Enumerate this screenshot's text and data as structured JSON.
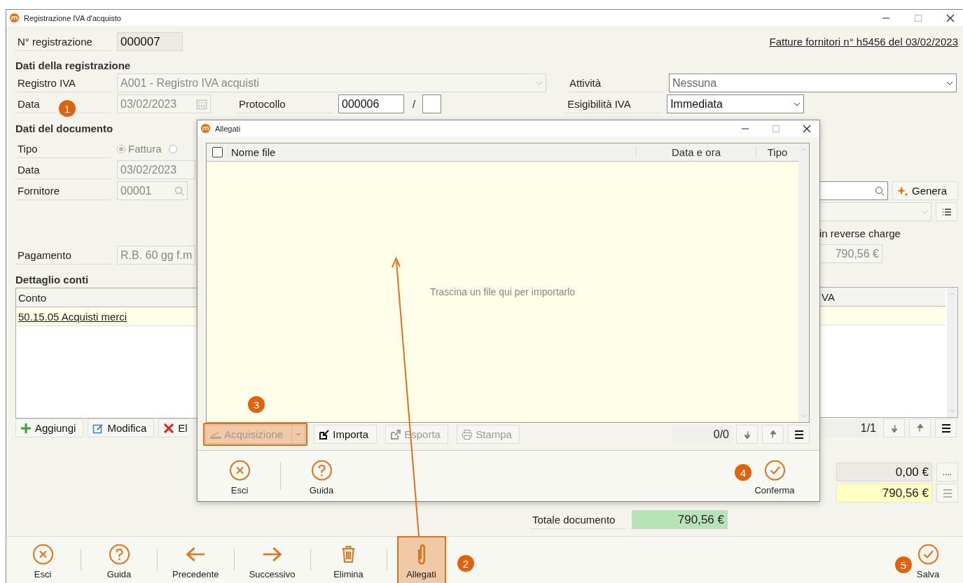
{
  "window": {
    "title": "Registrazione IVA d'acquisto"
  },
  "header": {
    "registration_label": "N° registrazione",
    "registration_number": "000007",
    "invoice_link": "Fatture fornitori n° h5456 del 03/02/2023"
  },
  "registration_section": {
    "title": "Dati della registrazione",
    "registro_label": "Registro IVA",
    "registro_value": "A001 - Registro IVA acquisti",
    "date_label": "Data",
    "date_value": "03/02/2023",
    "protocol_label": "Protocollo",
    "protocol_value": "000006",
    "protocol_separator": "/",
    "activity_label": "Attività",
    "activity_value": "Nessuna",
    "vat_label": "Esigibilità IVA",
    "vat_value": "Immediata"
  },
  "document_section": {
    "title": "Dati del documento",
    "type_label": "Tipo",
    "type_options": [
      {
        "label": "Fattura",
        "selected": true
      },
      {
        "selected": false
      }
    ],
    "date_label": "Data",
    "date_value": "03/02/2023",
    "supplier_label": "Fornitore",
    "supplier_code": "00001",
    "generate_button": "Genera",
    "reverse_charge_label": "in reverse charge",
    "reverse_charge_amount": "790,56 €",
    "payment_label": "Pagamento",
    "payment_value": "R.B. 60 gg f.m"
  },
  "accounts": {
    "title": "Dettaglio conti",
    "columns": [
      "Conto",
      "VA"
    ],
    "rows": [
      {
        "account": "50.15.05 Acquisti merci"
      }
    ],
    "buttons": [
      {
        "label": "Aggiungi",
        "kind": "plus"
      },
      {
        "label": "Modifica",
        "kind": "edit"
      },
      {
        "label": "El",
        "kind": "cross"
      }
    ],
    "pager": "1/1"
  },
  "totals": {
    "amount_1": "0,00 €",
    "amount_1_button": "....",
    "amount_2": "790,56 €",
    "total_label": "Totale documento",
    "total_value": "790,56 €"
  },
  "toolbar": [
    {
      "label": "Esci",
      "kind": "close",
      "highlighted": false
    },
    {
      "label": "Guida",
      "kind": "help",
      "highlighted": false
    },
    {
      "label": "Precedente",
      "kind": "left",
      "highlighted": false
    },
    {
      "label": "Successivo",
      "kind": "right",
      "highlighted": false
    },
    {
      "label": "Elimina",
      "kind": "trash",
      "highlighted": false
    },
    {
      "label": "Allegati",
      "kind": "paperclip",
      "highlighted": true
    }
  ],
  "save_button": {
    "label": "Salva",
    "kind": "check"
  },
  "dialog": {
    "title": "Allegati",
    "select_all_checked": false,
    "columns": [
      "Nome file",
      "Data e ora",
      "Tipo"
    ],
    "empty_message": "Trascina un file qui per importarlo",
    "actions": [
      {
        "label": "Acquisizione",
        "kind": "scanner",
        "disabled": true,
        "highlighted": true,
        "dropdown": true
      },
      {
        "label": "Importa",
        "kind": "import",
        "disabled": false,
        "highlighted": false,
        "dropdown": false
      },
      {
        "label": "Esporta",
        "kind": "export",
        "disabled": true,
        "highlighted": false,
        "dropdown": false
      },
      {
        "label": "Stampa",
        "kind": "printer",
        "disabled": true,
        "highlighted": false,
        "dropdown": false
      }
    ],
    "pager": "0/0",
    "footer": [
      {
        "label": "Esci",
        "kind": "close"
      },
      {
        "label": "Guida",
        "kind": "help"
      },
      {
        "label": "Conferma",
        "kind": "check"
      }
    ]
  },
  "callouts": [
    "1",
    "2",
    "3",
    "4",
    "5"
  ]
}
